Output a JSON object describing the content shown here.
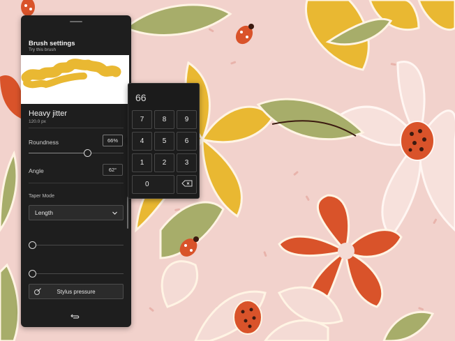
{
  "panel": {
    "title": "Brush settings",
    "subtitle": "Try this brush",
    "brush_name": "Heavy jitter",
    "brush_size": "120.0 px",
    "roundness_label": "Roundness",
    "roundness_value": "66%",
    "roundness_level": 0.66,
    "angle_label": "Angle",
    "angle_value": "62°",
    "taper_mode_label": "Taper Mode",
    "taper_mode_value": "Length",
    "stylus_button_label": "Stylus pressure"
  },
  "keypad": {
    "display": "66",
    "keys": [
      "7",
      "8",
      "9",
      "4",
      "5",
      "6",
      "1",
      "2",
      "3",
      "0"
    ]
  },
  "icons": {
    "dropdown": "chevron-down-icon",
    "stylus": "stylus-icon",
    "backspace": "backspace-icon",
    "undo": "undo-icon"
  },
  "colors": {
    "background_pink": "#f2d2cc",
    "brush_stroke": "#e9b832",
    "panel": "#1e1e1e"
  }
}
